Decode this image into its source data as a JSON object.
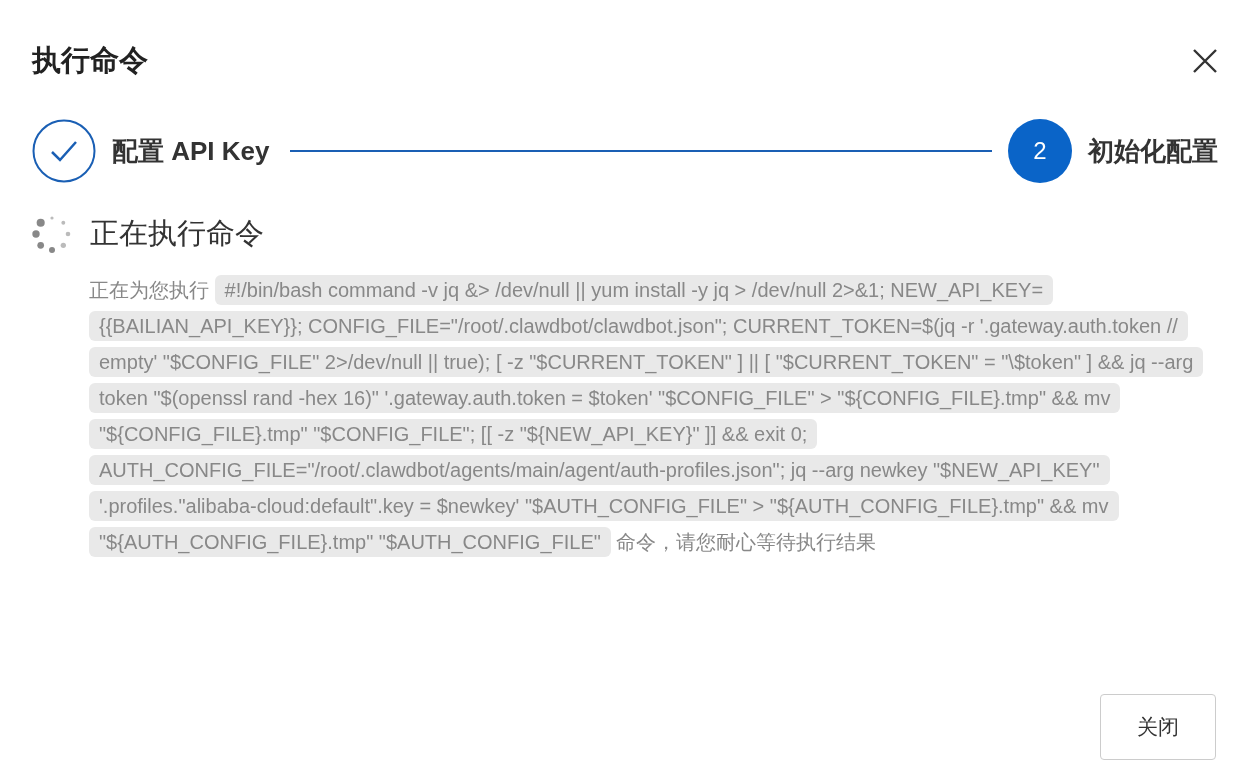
{
  "dialog": {
    "title": "执行命令"
  },
  "steps": [
    {
      "label": "配置 API Key",
      "completed": true
    },
    {
      "number": "2",
      "label": "初始化配置",
      "completed": false
    }
  ],
  "progress": {
    "heading": "正在执行命令",
    "running": true
  },
  "message": {
    "prefix": "正在为您执行",
    "command": "#!/bin/bash command -v jq &> /dev/null || yum install -y jq > /dev/null 2>&1; NEW_API_KEY={{BAILIAN_API_KEY}}; CONFIG_FILE=\"/root/.clawdbot/clawdbot.json\"; CURRENT_TOKEN=$(jq -r '.gateway.auth.token // empty' \"$CONFIG_FILE\" 2>/dev/null || true); [ -z \"$CURRENT_TOKEN\" ] || [ \"$CURRENT_TOKEN\" = \"\\$token\" ] && jq --arg token \"$(openssl rand -hex 16)\" '.gateway.auth.token = $token' \"$CONFIG_FILE\" > \"${CONFIG_FILE}.tmp\" && mv \"${CONFIG_FILE}.tmp\" \"$CONFIG_FILE\"; [[ -z \"${NEW_API_KEY}\" ]] && exit 0; AUTH_CONFIG_FILE=\"/root/.clawdbot/agents/main/agent/auth-profiles.json\"; jq --arg newkey \"$NEW_API_KEY\" '.profiles.\"alibaba-cloud:default\".key = $newkey' \"$AUTH_CONFIG_FILE\" > \"${AUTH_CONFIG_FILE}.tmp\" && mv \"${AUTH_CONFIG_FILE}.tmp\" \"$AUTH_CONFIG_FILE\"",
    "suffix": "命令，请您耐心等待执行结果"
  },
  "buttons": [
    {
      "label": "关闭"
    }
  ]
}
